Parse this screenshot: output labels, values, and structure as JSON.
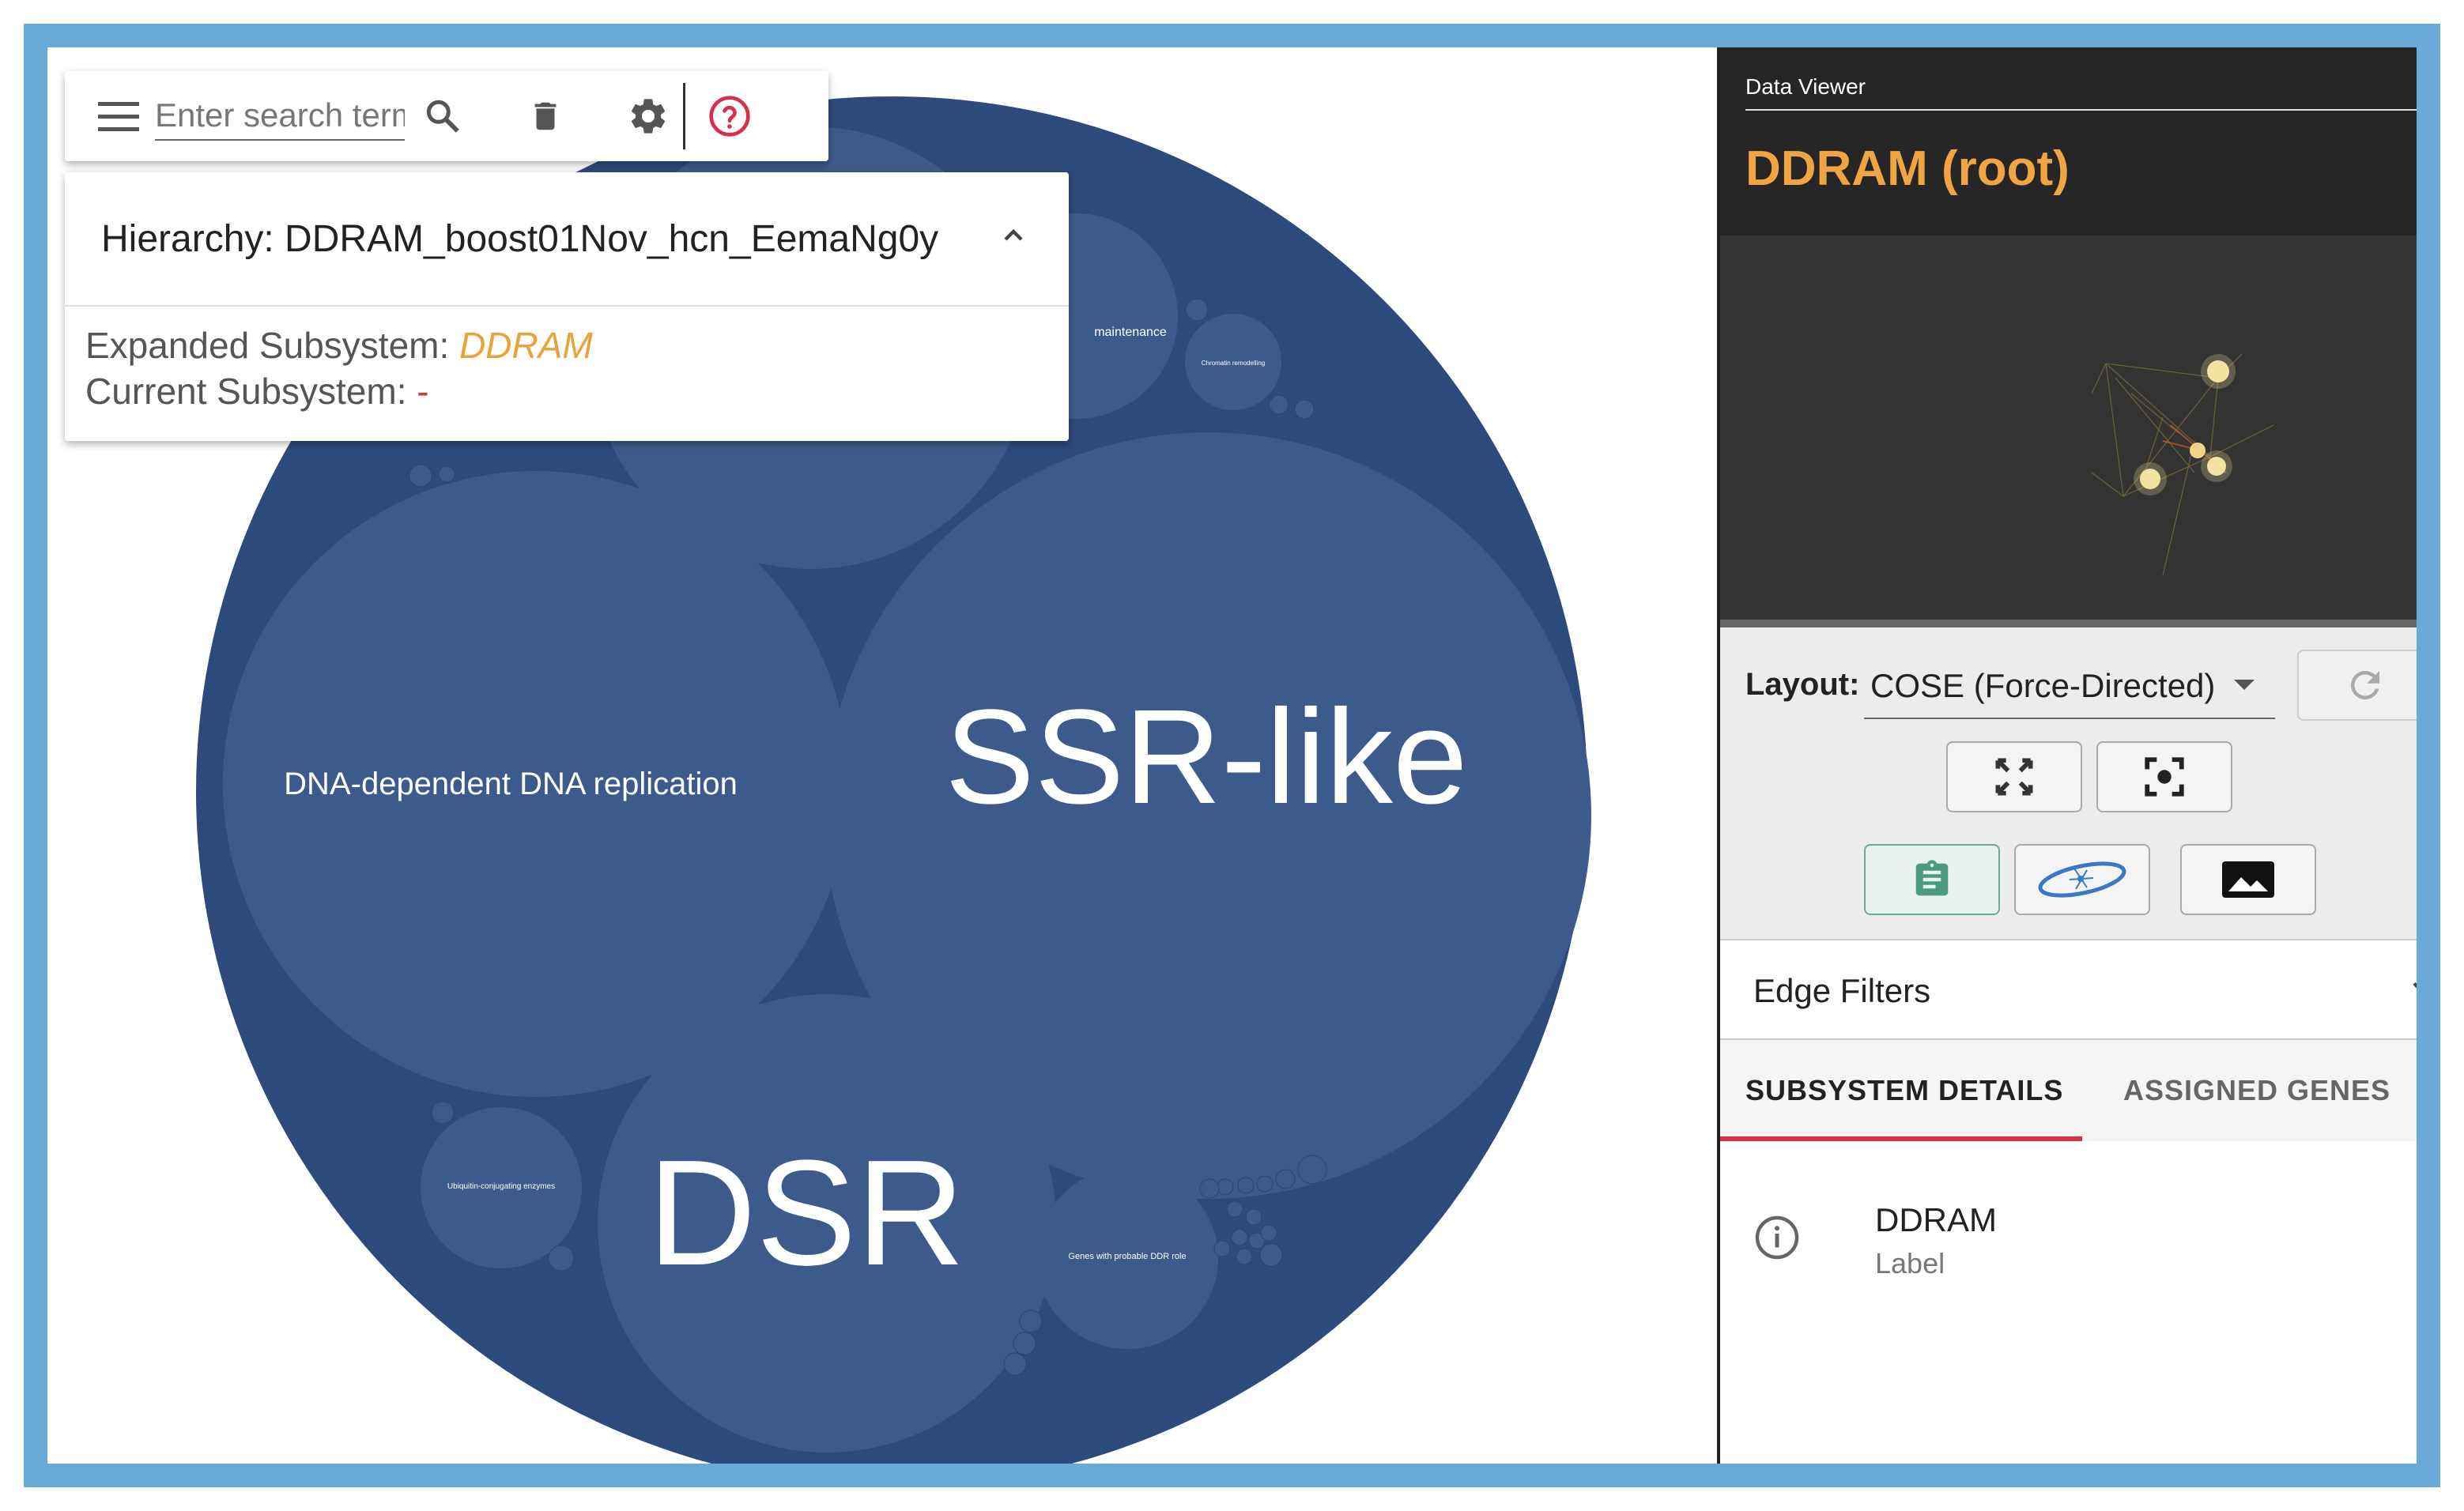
{
  "toolbar": {
    "search_placeholder": "Enter search terms",
    "icons": [
      "menu-icon",
      "search-icon",
      "delete-icon",
      "settings-icon",
      "help-icon"
    ]
  },
  "hierarchy": {
    "title": "Hierarchy: DDRAM_boost01Nov_hcn_EemaNg0y",
    "expanded_label": "Expanded Subsystem: ",
    "expanded_value": "DDRAM",
    "current_label": "Current Subsystem: ",
    "current_value": "-"
  },
  "visualization": {
    "labels": {
      "dna_replication": "DNA-dependent DNA replication",
      "ssr_like": "SSR-like",
      "dsr": "DSR",
      "ubiquitin": "Ubiquitin-conjugating enzymes",
      "ddr_genes": "Genes with probable DDR role",
      "maintenance": "maintenance",
      "chromatin": "Chromatin remodelling"
    }
  },
  "data_viewer": {
    "section_label": "Data Viewer",
    "title": "DDRAM (root)",
    "layout_label": "Layout:",
    "layout_value": "COSE (Force-Directed)",
    "edge_filters": "Edge Filters",
    "tabs": [
      "SUBSYSTEM DETAILS",
      "ASSIGNED GENES"
    ],
    "detail_name": "DDRAM",
    "detail_sub": "Label"
  },
  "colors": {
    "outer_circle": "#2d4a7c",
    "inner_circle": "#3c5b8c",
    "accent_orange": "#f0a542",
    "frame_blue": "#6baad8",
    "tab_indicator": "#d6304a"
  }
}
